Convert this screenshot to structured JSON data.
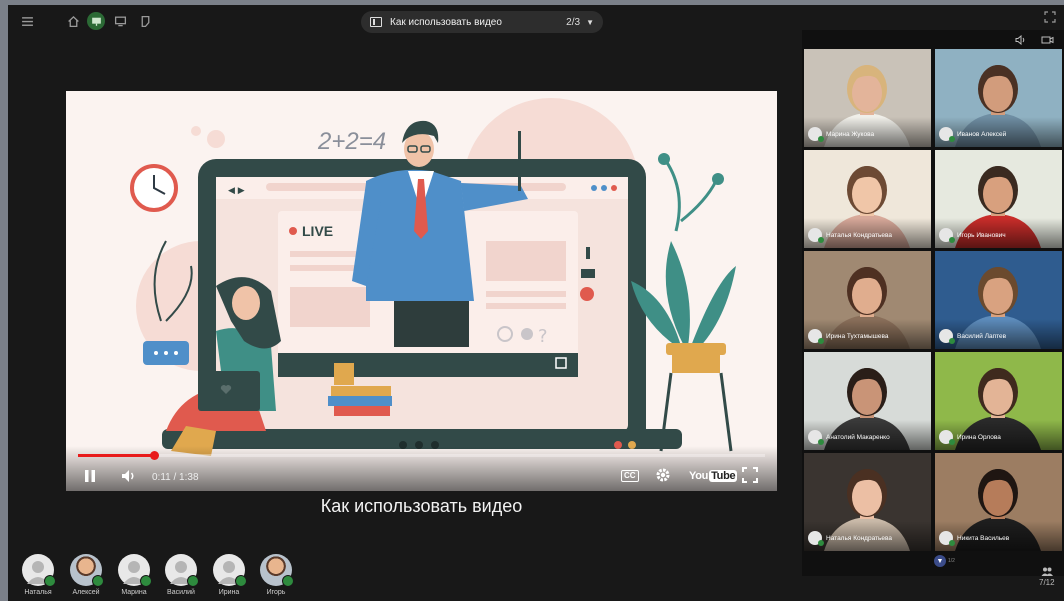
{
  "toolbar": {
    "icons": [
      "menu-icon",
      "home-icon",
      "presentation-icon",
      "monitor-icon",
      "whiteboard-icon"
    ],
    "active_icon": "presentation-icon"
  },
  "presentation": {
    "title": "Как использовать видео",
    "counter": "2/3"
  },
  "video": {
    "time": "0:11 / 1:38",
    "progress": 0.11,
    "caption": "Как использовать видео",
    "live_label": "LIVE",
    "formula": "2+2=4",
    "youtube_label_a": "You",
    "youtube_label_b": "Tube",
    "cc_label": "CC"
  },
  "bottom_participants": [
    {
      "name": "Наталья",
      "face": false
    },
    {
      "name": "Алексей",
      "face": true
    },
    {
      "name": "Марина",
      "face": false
    },
    {
      "name": "Василий",
      "face": false
    },
    {
      "name": "Ирина",
      "face": false
    },
    {
      "name": "Игорь",
      "face": true
    }
  ],
  "tiles": [
    {
      "name": "Марина Жукова",
      "bg": "#c9c2b8",
      "skin": "#e3b49a",
      "hair": "#d8b47c",
      "shirt": "#f0efe9"
    },
    {
      "name": "Иванов Алексей",
      "bg": "#8fb1c2",
      "skin": "#d29c7c",
      "hair": "#4a3124",
      "shirt": "#6f8ea3"
    },
    {
      "name": "Наталья Кондратьева",
      "bg": "#efe7da",
      "skin": "#f0c6a8",
      "hair": "#6d4a34",
      "shirt": "#d8a99a"
    },
    {
      "name": "Игорь Иванович",
      "bg": "#e6e9df",
      "skin": "#d8a07e",
      "hair": "#3a2a20",
      "shirt": "#c92d2a"
    },
    {
      "name": "Ирина Тухтамышева",
      "bg": "#a08972",
      "skin": "#e0ad8e",
      "hair": "#4e3022",
      "shirt": "#8a6f5a"
    },
    {
      "name": "Василий Лаптев",
      "bg": "#2f5c8f",
      "skin": "#d9a280",
      "hair": "#6b4a2e",
      "shirt": "#5d8cbc"
    },
    {
      "name": "Анатолий Макаренко",
      "bg": "#d7dbd8",
      "skin": "#c99477",
      "hair": "#2a1e18",
      "shirt": "#3a3a3a"
    },
    {
      "name": "Ирина Орлова",
      "bg": "#8fb84a",
      "skin": "#e3b496",
      "hair": "#3f2a1e",
      "shirt": "#2a2a2a"
    },
    {
      "name": "Наталья Кондратьева",
      "bg": "#3a3430",
      "skin": "#ecbfa4",
      "hair": "#4a3022",
      "shirt": "#c9b9a8"
    },
    {
      "name": "Никита Васильев",
      "bg": "#9c7d62",
      "skin": "#b67c5a",
      "hair": "#1f1612",
      "shirt": "#1e1e1e"
    }
  ],
  "panel": {
    "scroll_label": "1/2",
    "people_count": "7/12"
  }
}
